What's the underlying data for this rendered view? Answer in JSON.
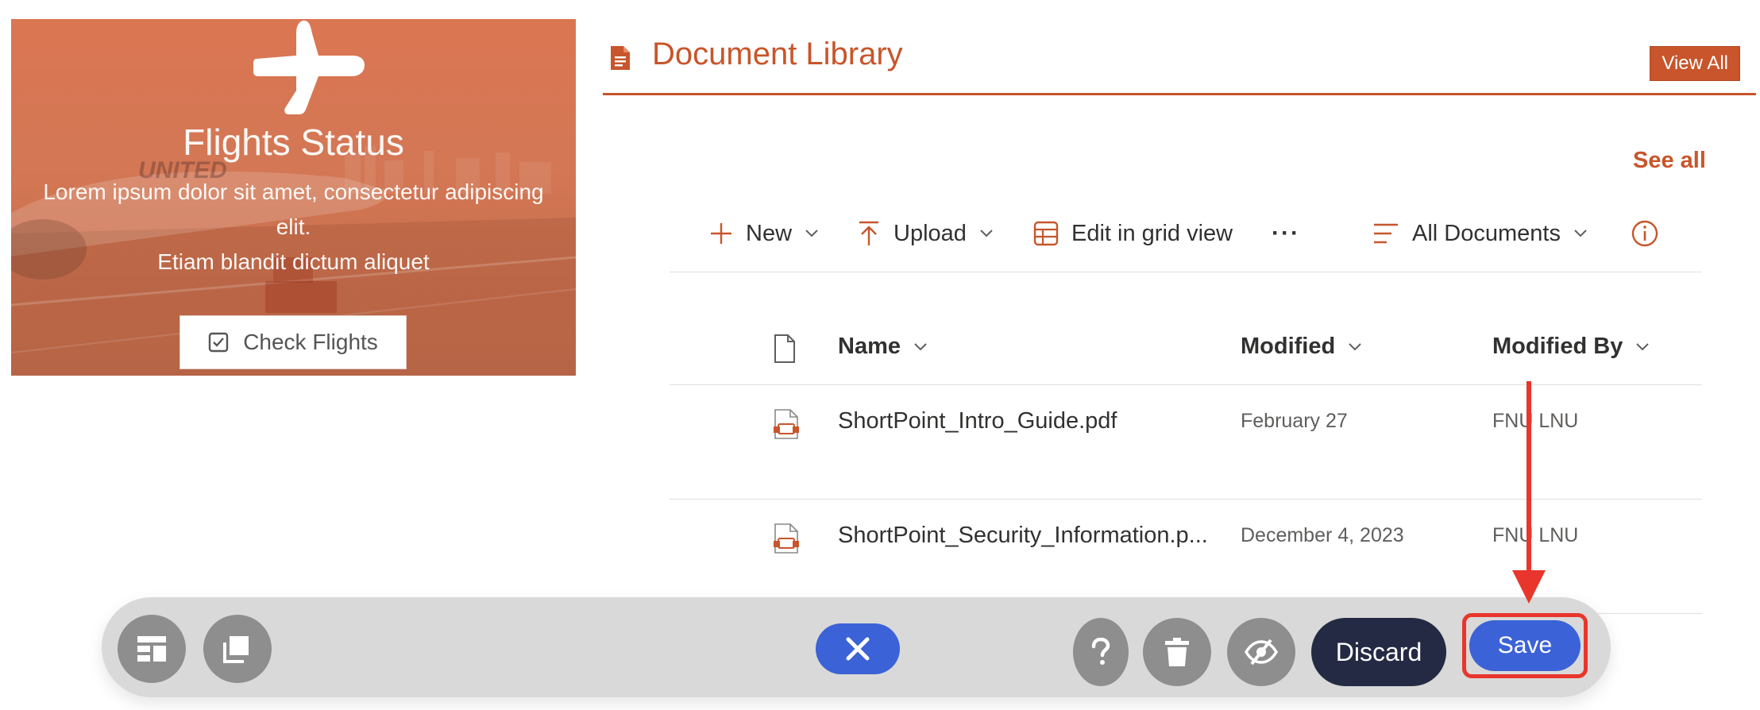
{
  "flights_card": {
    "title": "Flights Status",
    "description_line1": "Lorem ipsum dolor sit amet, consectetur adipiscing",
    "description_line2": "elit.",
    "description_line3": "Etiam blandit dictum aliquet",
    "button_label": "Check Flights",
    "background_color": "#d86e46"
  },
  "document_library": {
    "title": "Document Library",
    "view_all_label": "View All",
    "see_all_label": "See all",
    "accent_color": "#c8552b",
    "commands": {
      "new_label": "New",
      "upload_label": "Upload",
      "edit_grid_label": "Edit in grid view",
      "more_label": "···",
      "view_label": "All Documents"
    },
    "columns": [
      "Name",
      "Modified",
      "Modified By"
    ],
    "rows": [
      {
        "name": "ShortPoint_Intro_Guide.pdf",
        "modified": "February 27",
        "modified_by": "FNU LNU"
      },
      {
        "name": "ShortPoint_Security_Information.p...",
        "modified": "December 4, 2023",
        "modified_by": "FNU LNU"
      }
    ]
  },
  "toolbar": {
    "discard_label": "Discard",
    "save_label": "Save",
    "primary_color": "#3b62d6",
    "dark_color": "#252a44",
    "highlight_color": "#e8362c",
    "icons": [
      "layout-icon",
      "layers-icon",
      "close-icon",
      "help-icon",
      "trash-icon",
      "hide-icon"
    ]
  }
}
